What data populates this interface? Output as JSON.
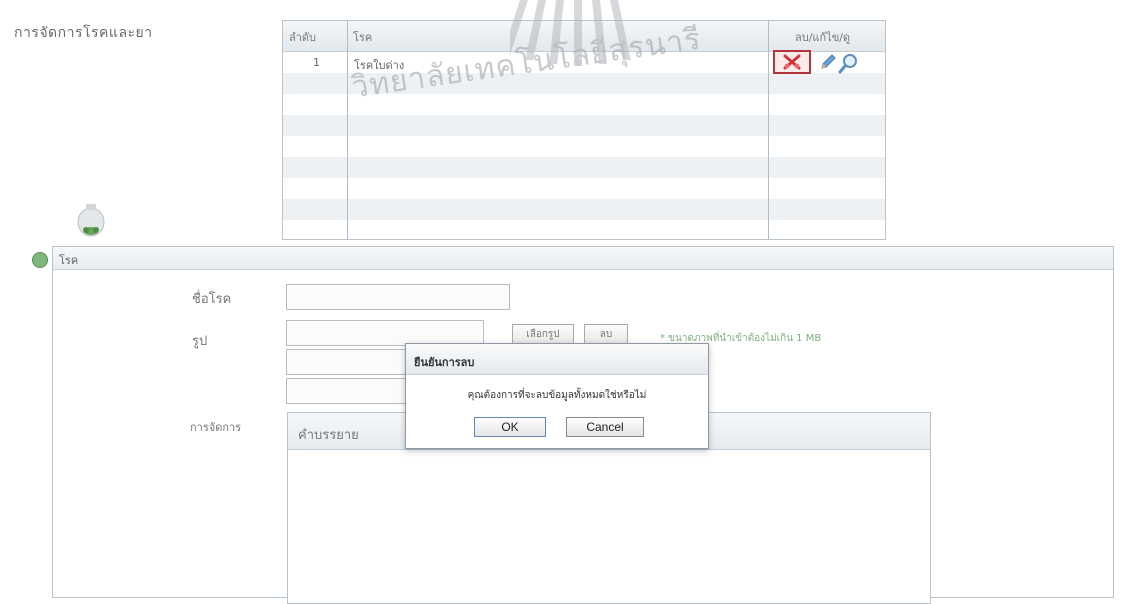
{
  "page": {
    "heading": "การจัดการโรคและยา"
  },
  "table": {
    "headers": {
      "index": "ลำดับ",
      "name": "โรค",
      "actions": "ลบ/แก้ไข/ดู"
    },
    "rows": [
      {
        "index": "1",
        "name": "โรคใบด่าง"
      }
    ],
    "action_icons": [
      "delete-icon",
      "edit-icon",
      "view-icon"
    ]
  },
  "watermark": {
    "text": "วิทยาลัยเทคโนโลยีสุรนารี"
  },
  "panel": {
    "title": "โรค",
    "name_label": "ชื่อโรค",
    "image_label": "รูป",
    "browse_button": "เลือกรูป",
    "delete_button": "ลบ",
    "hint": "* ขนาดภาพที่นำเข้าต้องไม่เกิน 1 MB",
    "manage_label": "การจัดการ",
    "description_title": "คำบรรยาย"
  },
  "dialog": {
    "title": "ยืนยันการลบ",
    "message": "คุณต้องการที่จะลบข้อมูลทั้งหมดใช่หรือไม่",
    "ok": "OK",
    "cancel": "Cancel"
  },
  "colors": {
    "delete_border": "#b3343a",
    "hint_green": "#7fb07f"
  }
}
